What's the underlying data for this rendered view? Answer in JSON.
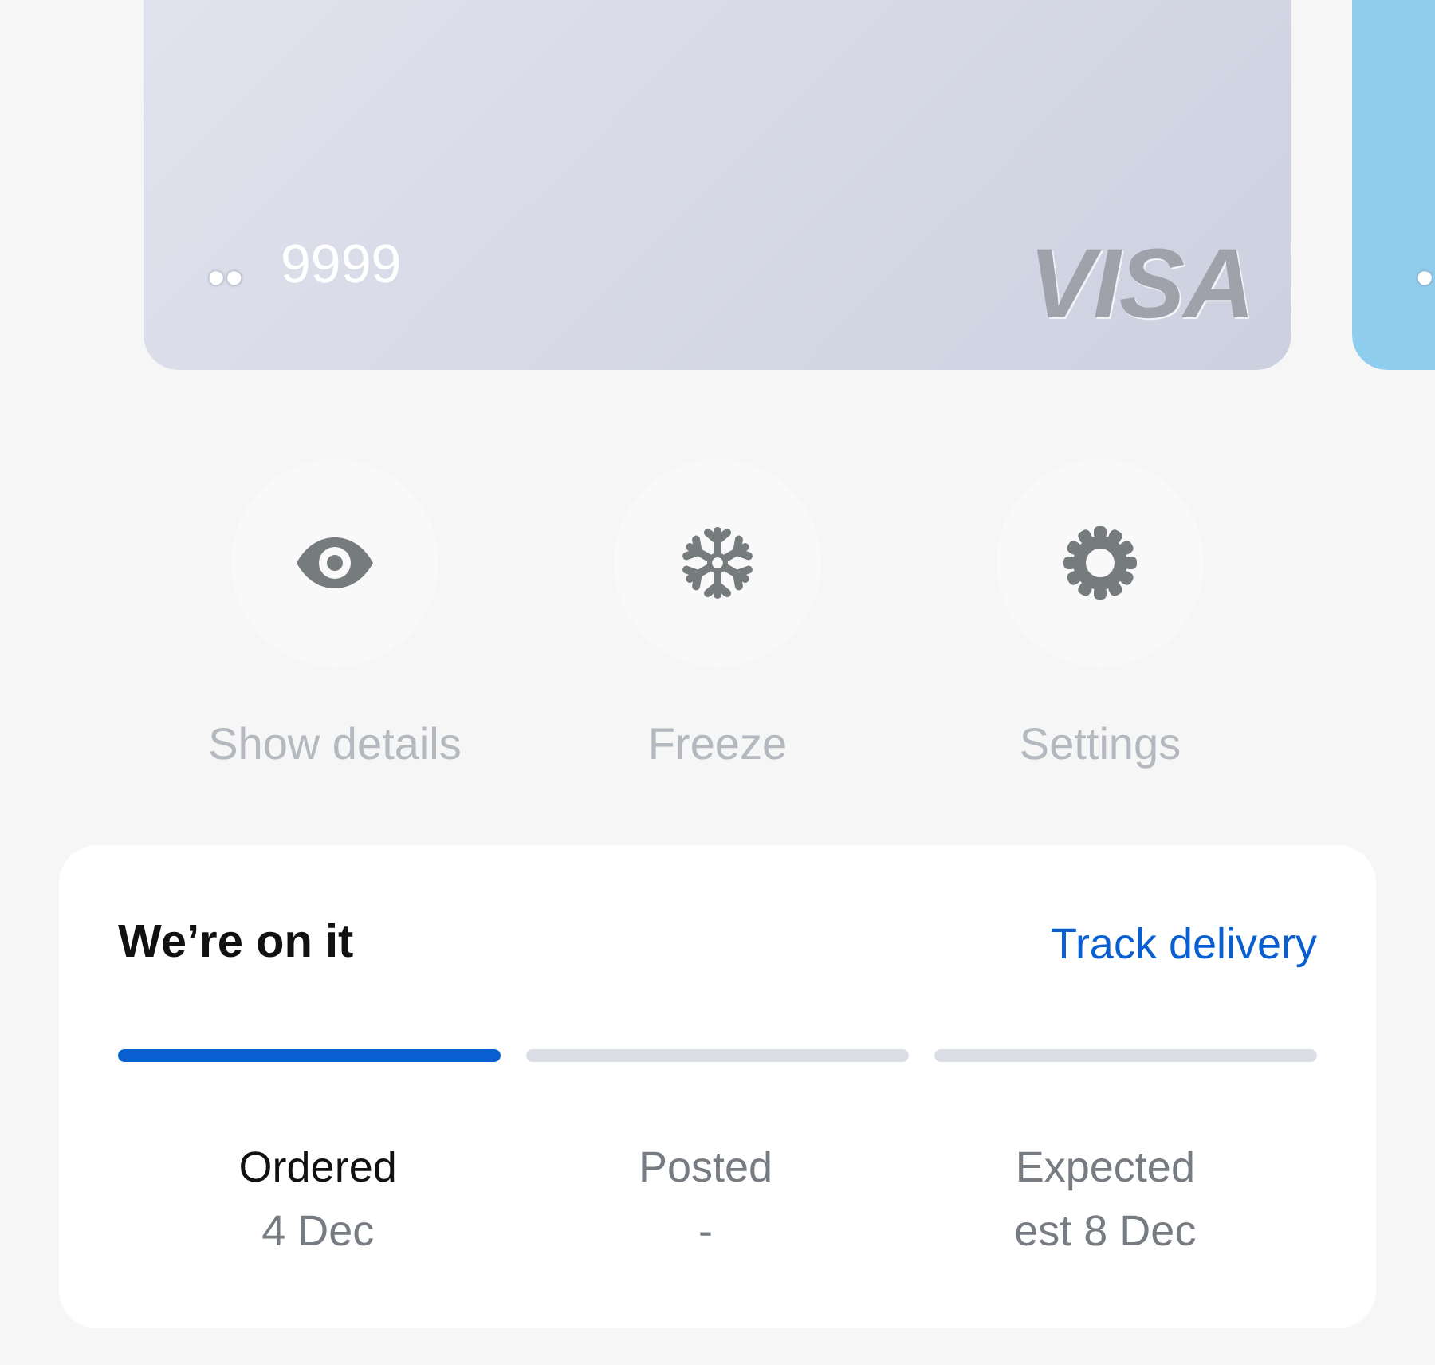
{
  "cards": [
    {
      "masked_digits": "••",
      "last_digits": "9999",
      "network": "VISA",
      "kind": "silver"
    },
    {
      "masked_digits": "•",
      "kind": "blue"
    }
  ],
  "actions": [
    {
      "label": "Show details",
      "kind": "eye"
    },
    {
      "label": "Freeze",
      "kind": "snowflake"
    },
    {
      "label": "Settings",
      "kind": "gear"
    }
  ],
  "delivery": {
    "title": "We’re on it",
    "link": "Track delivery",
    "steps": [
      {
        "label": "Ordered",
        "date": "4 Dec",
        "done": true
      },
      {
        "label": "Posted",
        "date": "-",
        "done": false
      },
      {
        "label": "Expected",
        "date": "est 8 Dec",
        "done": false
      }
    ]
  }
}
